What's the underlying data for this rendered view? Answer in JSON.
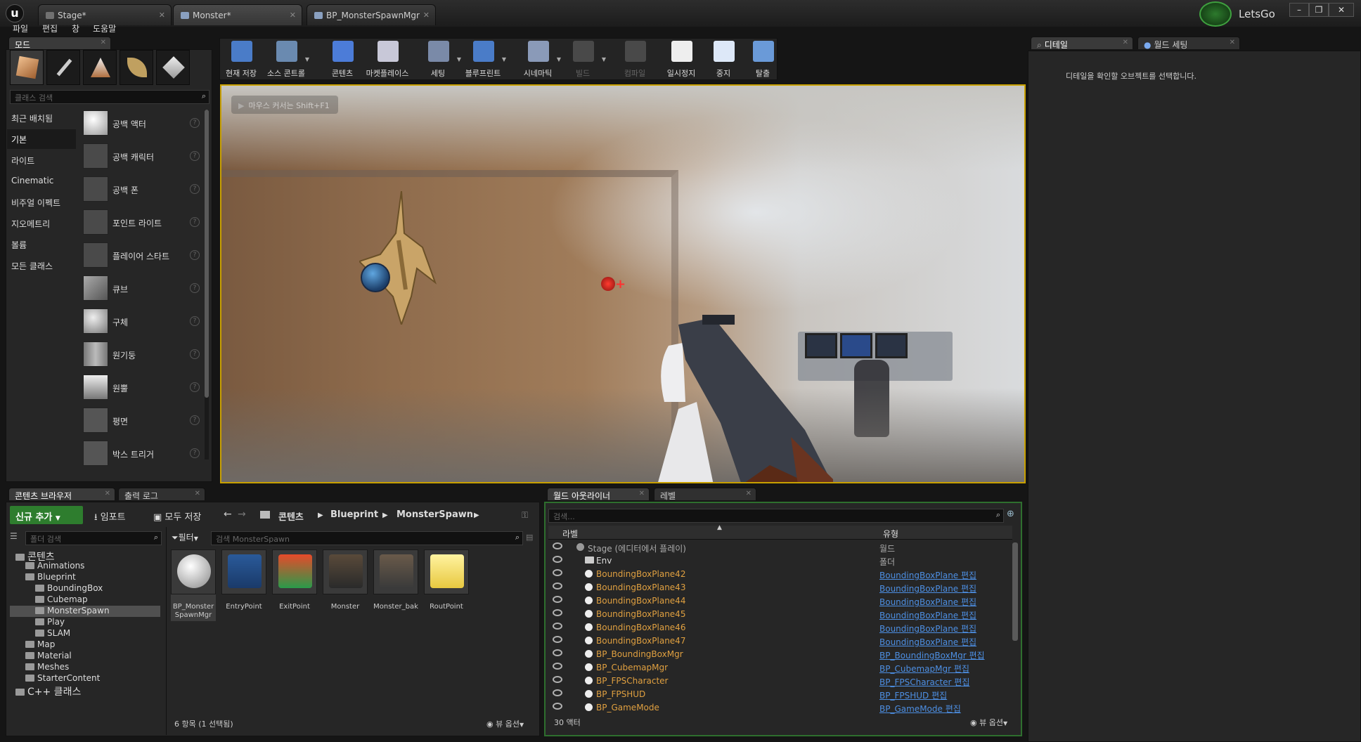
{
  "titlebar": {
    "tabs": [
      "Stage*",
      "Monster*",
      "BP_MonsterSpawnMgr"
    ],
    "project": "LetsGo",
    "controls": [
      "–",
      "❐",
      "✕"
    ]
  },
  "menu": [
    "파일",
    "편집",
    "창",
    "도움말"
  ],
  "modes": {
    "tab": "모드",
    "search_placeholder": "클래스 검색",
    "categories": [
      "최근 배치됨",
      "기본",
      "라이트",
      "Cinematic",
      "비주얼 이펙트",
      "지오메트리",
      "볼륨",
      "모든 클래스"
    ],
    "items": [
      "공백 액터",
      "공백 캐릭터",
      "공백 폰",
      "포인트 라이트",
      "플레이어 스타트",
      "큐브",
      "구체",
      "원기둥",
      "원뿔",
      "평면",
      "박스 트리거"
    ]
  },
  "toolbar": [
    "현재 저장",
    "소스 콘트롤",
    "콘텐츠",
    "마켓플레이스",
    "세팅",
    "블루프린트",
    "시네마틱",
    "빌드",
    "컴파일",
    "일시정지",
    "중지",
    "탈출"
  ],
  "viewport": {
    "hint": "마우스 커서는 Shift+F1"
  },
  "details": {
    "tabs": [
      "디테일",
      "월드 세팅"
    ],
    "message": "디테일을 확인할 오브젝트를 선택합니다."
  },
  "content_browser": {
    "tabs": [
      "콘텐츠 브라우저",
      "출력 로그"
    ],
    "add_new": "신규 추가",
    "import": "임포트",
    "save_all": "모두 저장",
    "breadcrumb": [
      "콘텐츠",
      "Blueprint",
      "MonsterSpawn"
    ],
    "folder_search": "폴더 검색",
    "filter": "필터",
    "asset_search": "검색 MonsterSpawn",
    "tree": [
      {
        "label": "콘텐츠",
        "depth": 0,
        "big": true
      },
      {
        "label": "Animations",
        "depth": 1
      },
      {
        "label": "Blueprint",
        "depth": 1
      },
      {
        "label": "BoundingBox",
        "depth": 2
      },
      {
        "label": "Cubemap",
        "depth": 2
      },
      {
        "label": "MonsterSpawn",
        "depth": 2,
        "selected": true
      },
      {
        "label": "Play",
        "depth": 2
      },
      {
        "label": "SLAM",
        "depth": 2
      },
      {
        "label": "Map",
        "depth": 1
      },
      {
        "label": "Material",
        "depth": 1
      },
      {
        "label": "Meshes",
        "depth": 1
      },
      {
        "label": "StarterContent",
        "depth": 1
      },
      {
        "label": "C++ 클래스",
        "depth": 0,
        "big": true
      }
    ],
    "assets": [
      "BP_Monster\nSpawnMgr",
      "EntryPoint",
      "ExitPoint",
      "Monster",
      "Monster_bak",
      "RoutPoint"
    ],
    "status": "6 항목 (1 선택됨)",
    "view_options": "뷰 옵션"
  },
  "outliner": {
    "tabs": [
      "월드 아웃라이너",
      "레벨"
    ],
    "search_placeholder": "검색...",
    "col_label": "라벨",
    "col_type": "유형",
    "rows": [
      {
        "label": "Stage (에디터에서 플레이)",
        "type": "월드",
        "link": false,
        "root": true
      },
      {
        "label": "Env",
        "type": "폴더",
        "link": false,
        "folder": true
      },
      {
        "label": "BoundingBoxPlane42",
        "type": "BoundingBoxPlane 편집",
        "link": true
      },
      {
        "label": "BoundingBoxPlane43",
        "type": "BoundingBoxPlane 편집",
        "link": true
      },
      {
        "label": "BoundingBoxPlane44",
        "type": "BoundingBoxPlane 편집",
        "link": true
      },
      {
        "label": "BoundingBoxPlane45",
        "type": "BoundingBoxPlane 편집",
        "link": true
      },
      {
        "label": "BoundingBoxPlane46",
        "type": "BoundingBoxPlane 편집",
        "link": true
      },
      {
        "label": "BoundingBoxPlane47",
        "type": "BoundingBoxPlane 편집",
        "link": true
      },
      {
        "label": "BP_BoundingBoxMgr",
        "type": "BP_BoundingBoxMgr 편집",
        "link": true
      },
      {
        "label": "BP_CubemapMgr",
        "type": "BP_CubemapMgr 편집",
        "link": true
      },
      {
        "label": "BP_FPSCharacter",
        "type": "BP_FPSCharacter 편집",
        "link": true
      },
      {
        "label": "BP_FPSHUD",
        "type": "BP_FPSHUD 편집",
        "link": true
      },
      {
        "label": "BP_GameMode",
        "type": "BP_GameMode 편집",
        "link": true
      }
    ],
    "count": "30 액터",
    "view_options": "뷰 옵션"
  },
  "colors": {
    "accent_green": "#2e7d2e",
    "viewport_border": "#c8a000",
    "actor_orange": "#e0a040",
    "link_blue": "#4d8fe3"
  }
}
